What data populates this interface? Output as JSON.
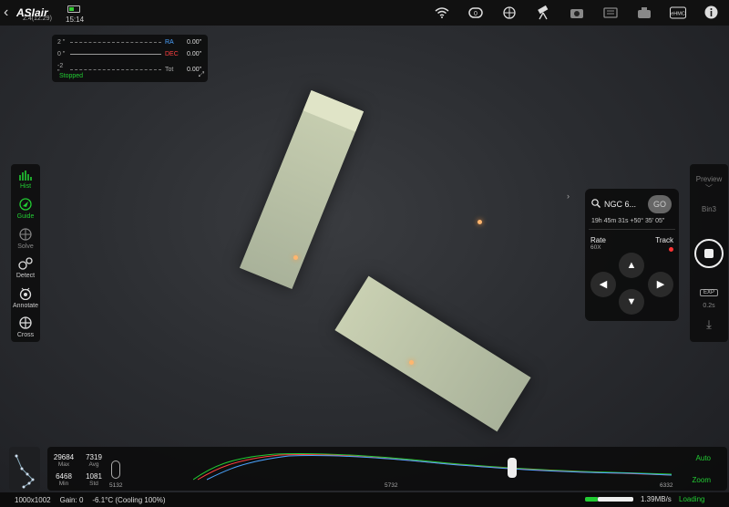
{
  "app": {
    "name": "ASIair",
    "version": "2.4(12.29)",
    "clock": "15:14"
  },
  "toolbar_icons": [
    "wifi-icon",
    "focuser-icon",
    "mount-icon",
    "telescope-icon",
    "camera-icon",
    "filter-icon",
    "guide-camera-icon",
    "ehmc-icon",
    "info-icon"
  ],
  "toolbar_ehmc_label": "eHMC",
  "guide_graph": {
    "y_ticks": [
      "2 \"",
      "0 \"",
      "-2 \""
    ],
    "axes": [
      {
        "name": "RA",
        "value": "0.00\""
      },
      {
        "name": "DEC",
        "value": "0.00\""
      },
      {
        "name": "Tot",
        "value": "0.00\""
      }
    ],
    "status": "Stopped",
    "colors": {
      "RA": "#4aa3ff",
      "DEC": "#ff4040",
      "status": "#22cc33"
    }
  },
  "left_tools": [
    {
      "label": "Hist",
      "icon": "histogram-icon",
      "state": "active"
    },
    {
      "label": "Guide",
      "icon": "guide-icon",
      "state": "active"
    },
    {
      "label": "Solve",
      "icon": "solve-icon",
      "state": "dim"
    },
    {
      "label": "Detect",
      "icon": "detect-icon",
      "state": "normal"
    },
    {
      "label": "Annotate",
      "icon": "annotate-icon",
      "state": "normal"
    },
    {
      "label": "Cross",
      "icon": "crosshair-icon",
      "state": "normal"
    }
  ],
  "mount": {
    "target": "NGC 6...",
    "go_label": "GO",
    "coords": "19h 45m 31s +50° 35' 05\"",
    "rate_label": "Rate",
    "rate_value": "60X",
    "track_label": "Track"
  },
  "shoot": {
    "preview_label": "Preview",
    "bin_label": "Bin3",
    "exp_label": "EXP",
    "exp_value": "0.2s"
  },
  "histogram": {
    "max": "29684",
    "max_label": "Max",
    "avg": "7319",
    "avg_label": "Avg",
    "min": "6468",
    "min_label": "Min",
    "std": "1081",
    "std_label": "Std",
    "scale": [
      "5132",
      "5732",
      "6332"
    ],
    "auto_label": "Auto",
    "zoom_label": "Zoom"
  },
  "status_bar": {
    "resolution": "1000x1002",
    "gain": "Gain: 0",
    "temp": "-6.1°C (Cooling 100%)",
    "speed": "1.39MB/s",
    "loading": "Loading"
  }
}
